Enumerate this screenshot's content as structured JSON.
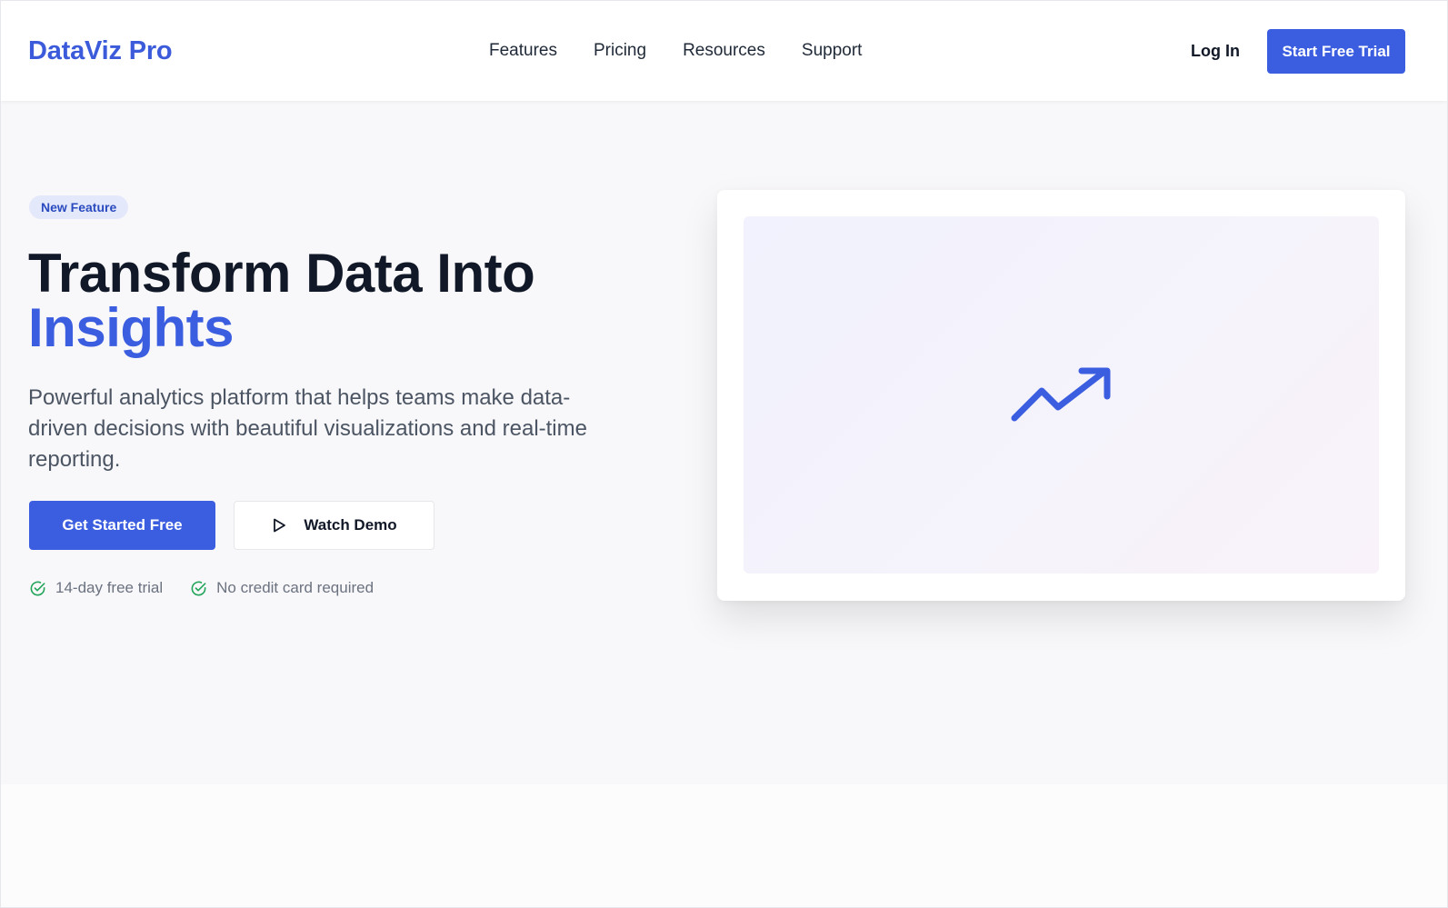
{
  "header": {
    "logo": "DataViz Pro",
    "nav": [
      "Features",
      "Pricing",
      "Resources",
      "Support"
    ],
    "login_label": "Log In",
    "trial_label": "Start Free Trial"
  },
  "hero": {
    "badge": "New Feature",
    "headline_line1": "Transform Data Into",
    "headline_accent": "Insights",
    "subtext": "Powerful analytics platform that helps teams make data-driven decisions with beautiful visualizations and real-time reporting.",
    "cta_primary": "Get Started Free",
    "cta_secondary": "Watch Demo",
    "checks": [
      "14-day free trial",
      "No credit card required"
    ]
  },
  "icons": {
    "play": "play-icon",
    "check": "check-circle-icon",
    "trend": "trending-up-icon"
  },
  "colors": {
    "brand": "#3b5de0",
    "check_green": "#22a55a",
    "badge_bg": "#e4e8fb"
  }
}
